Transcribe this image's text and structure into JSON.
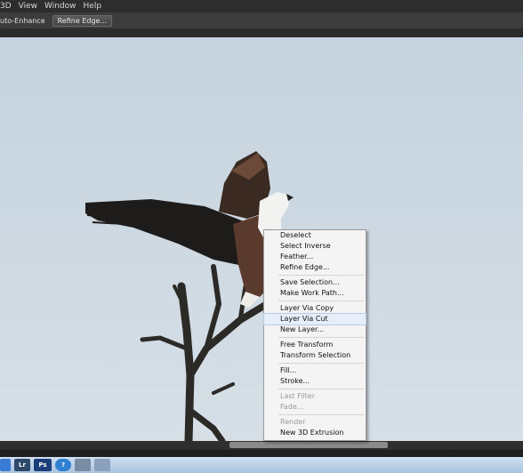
{
  "menubar": {
    "items": [
      "3D",
      "View",
      "Window",
      "Help"
    ]
  },
  "optionsbar": {
    "auto_enhance_label": "uto-Enhance",
    "refine_edge_button": "Refine Edge..."
  },
  "context_menu": {
    "groups": [
      [
        {
          "label": "Deselect",
          "enabled": true
        },
        {
          "label": "Select Inverse",
          "enabled": true
        },
        {
          "label": "Feather...",
          "enabled": true
        },
        {
          "label": "Refine Edge...",
          "enabled": true
        }
      ],
      [
        {
          "label": "Save Selection...",
          "enabled": true
        },
        {
          "label": "Make Work Path...",
          "enabled": true
        }
      ],
      [
        {
          "label": "Layer Via Copy",
          "enabled": true
        },
        {
          "label": "Layer Via Cut",
          "enabled": true,
          "highlighted": true
        },
        {
          "label": "New Layer...",
          "enabled": true
        }
      ],
      [
        {
          "label": "Free Transform",
          "enabled": true
        },
        {
          "label": "Transform Selection",
          "enabled": true
        }
      ],
      [
        {
          "label": "Fill...",
          "enabled": true
        },
        {
          "label": "Stroke...",
          "enabled": true
        }
      ],
      [
        {
          "label": "Last Filter",
          "enabled": false
        },
        {
          "label": "Fade...",
          "enabled": false
        }
      ],
      [
        {
          "label": "Render",
          "enabled": false
        },
        {
          "label": "New 3D Extrusion",
          "enabled": true
        }
      ]
    ]
  },
  "taskbar": {
    "buttons": [
      {
        "icon": "unknown-app-icon",
        "label": "",
        "color": "#3a7bd5"
      },
      {
        "icon": "lightroom-icon",
        "label": "Lr",
        "color": "#2e4a6b"
      },
      {
        "icon": "photoshop-icon",
        "label": "Ps",
        "color": "#1b3f7a"
      },
      {
        "icon": "help-icon",
        "label": "?",
        "color": "#2f7fd3"
      },
      {
        "icon": "app-icon",
        "label": "",
        "color": "#7a8ca3"
      },
      {
        "icon": "window-icon",
        "label": "",
        "color": "#8aa0bb"
      }
    ]
  }
}
